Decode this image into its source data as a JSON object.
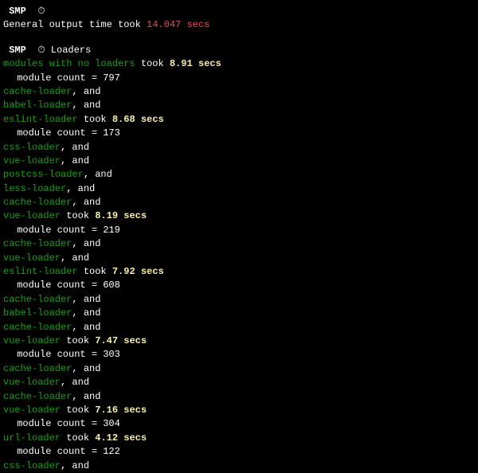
{
  "header": {
    "badge": "SMP",
    "icon": "⏱",
    "general_label": "General output time took ",
    "general_time": "14.047 secs"
  },
  "section": {
    "badge": "SMP",
    "icon": "⏱",
    "title": " Loaders"
  },
  "groups": [
    {
      "loaders": [
        "modules with no loaders"
      ],
      "took": " took ",
      "time": "8.91 secs",
      "module_count": " module count = 797"
    },
    {
      "loaders": [
        "cache-loader",
        "babel-loader",
        "eslint-loader"
      ],
      "took": " took ",
      "time": "8.68 secs",
      "module_count": " module count = 173"
    },
    {
      "loaders": [
        "css-loader",
        "vue-loader",
        "postcss-loader",
        "less-loader",
        "cache-loader",
        "vue-loader"
      ],
      "took": " took ",
      "time": "8.19 secs",
      "module_count": " module count = 219"
    },
    {
      "loaders": [
        "cache-loader",
        "vue-loader",
        "eslint-loader"
      ],
      "took": " took ",
      "time": "7.92 secs",
      "module_count": " module count = 608"
    },
    {
      "loaders": [
        "cache-loader",
        "babel-loader",
        "cache-loader",
        "vue-loader"
      ],
      "took": " took ",
      "time": "7.47 secs",
      "module_count": " module count = 303"
    },
    {
      "loaders": [
        "cache-loader",
        "vue-loader",
        "cache-loader",
        "vue-loader"
      ],
      "took": " took ",
      "time": "7.16 secs",
      "module_count": " module count = 304"
    },
    {
      "loaders": [
        "url-loader"
      ],
      "took": " took ",
      "time": "4.12 secs",
      "module_count": " module count = 122"
    },
    {
      "loaders": [
        "css-loader"
      ],
      "took": "",
      "time": "",
      "module_count": ""
    }
  ],
  "and_text": ", and"
}
